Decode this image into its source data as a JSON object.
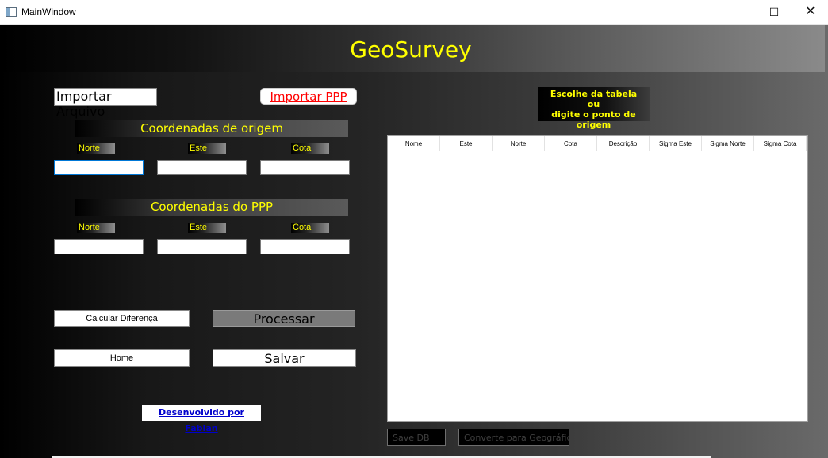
{
  "window": {
    "title": "MainWindow",
    "controls": {
      "minimize": "—",
      "maximize": "☐",
      "close": "✕"
    }
  },
  "banner": {
    "title": "GeoSurvey"
  },
  "buttons": {
    "import_file": "Importar Arquivo",
    "import_ppp": "Importar PPP",
    "calc_diff": "Calcular Diferença",
    "process": "Processar",
    "home": "Home",
    "save": "Salvar",
    "save_db": "Save DB",
    "convert": "Converte para Geográfico"
  },
  "origin": {
    "heading": "Coordenadas de origem",
    "labels": {
      "norte": "Norte",
      "este": "Este",
      "cota": "Cota"
    },
    "values": {
      "norte": "",
      "este": "",
      "cota": ""
    }
  },
  "ppp": {
    "heading": "Coordenadas do PPP",
    "labels": {
      "norte": "Norte",
      "este": "Este",
      "cota": "Cota"
    },
    "values": {
      "norte": "",
      "este": "",
      "cota": ""
    }
  },
  "hint": {
    "line1": "Escolhe da tabela",
    "line2": "ou",
    "line3": "digite o ponto de origem"
  },
  "table": {
    "columns": [
      "Nome",
      "Este",
      "Norte",
      "Cota",
      "Descrição",
      "Sigma Este",
      "Sigma Norte",
      "Sigma Cota"
    ],
    "rows": []
  },
  "footer": {
    "credit": "Desenvolvido por Fabian"
  },
  "colors": {
    "accent_yellow": "#ffff00",
    "link_red": "#ff0000",
    "link_blue": "#0000cc",
    "focus_blue": "#0078d7"
  }
}
